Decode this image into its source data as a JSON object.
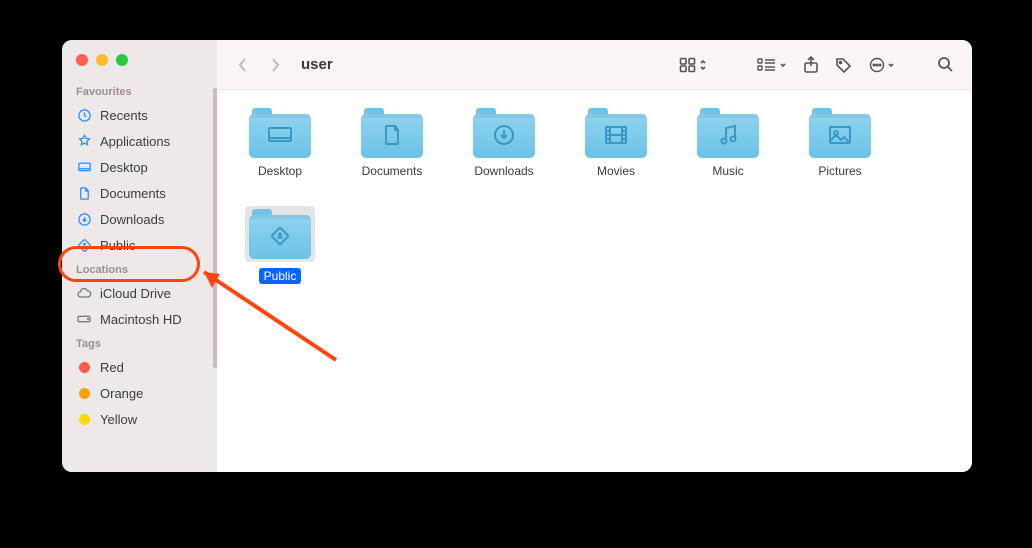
{
  "window": {
    "title": "user"
  },
  "sidebar": {
    "sections": {
      "favourites": {
        "label": "Favourites",
        "items": [
          {
            "icon": "recents-icon",
            "label": "Recents"
          },
          {
            "icon": "applications-icon",
            "label": "Applications"
          },
          {
            "icon": "desktop-icon",
            "label": "Desktop"
          },
          {
            "icon": "documents-icon",
            "label": "Documents"
          },
          {
            "icon": "downloads-icon",
            "label": "Downloads"
          },
          {
            "icon": "public-icon",
            "label": "Public"
          }
        ]
      },
      "locations": {
        "label": "Locations",
        "items": [
          {
            "icon": "icloud-icon",
            "label": "iCloud Drive"
          },
          {
            "icon": "disk-icon",
            "label": "Macintosh HD"
          }
        ]
      },
      "tags": {
        "label": "Tags",
        "items": [
          {
            "color": "#ff5b4d",
            "label": "Red"
          },
          {
            "color": "#ff9f0a",
            "label": "Orange"
          },
          {
            "color": "#ffd60a",
            "label": "Yellow"
          }
        ]
      }
    }
  },
  "folders": [
    {
      "name": "Desktop",
      "glyph": "desktop",
      "selected": false
    },
    {
      "name": "Documents",
      "glyph": "documents",
      "selected": false
    },
    {
      "name": "Downloads",
      "glyph": "downloads",
      "selected": false
    },
    {
      "name": "Movies",
      "glyph": "movies",
      "selected": false
    },
    {
      "name": "Music",
      "glyph": "music",
      "selected": false
    },
    {
      "name": "Pictures",
      "glyph": "pictures",
      "selected": false
    },
    {
      "name": "Public",
      "glyph": "public",
      "selected": true
    }
  ],
  "colors": {
    "accent": "#0a63ff",
    "folder": "#6cc2e6",
    "highlight": "#ff4412"
  }
}
